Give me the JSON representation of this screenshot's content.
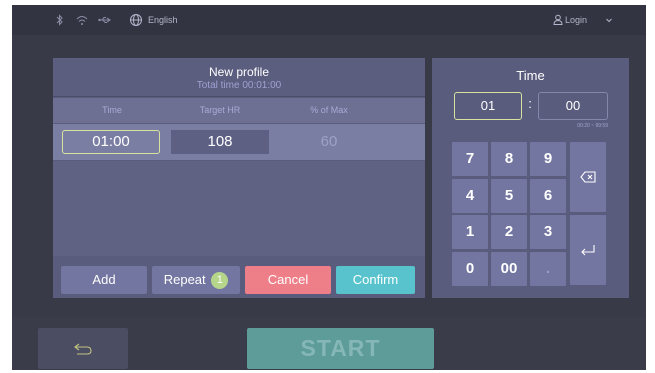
{
  "status_bar": {
    "language": "English",
    "login_label": "Login",
    "icons": [
      "bluetooth-icon",
      "wifi-icon",
      "usb-icon",
      "globe-icon",
      "user-icon",
      "chevron-down-icon"
    ]
  },
  "profile": {
    "title": "New profile",
    "subtitle": "Total time 00:01:00",
    "columns": [
      "Time",
      "Target HR",
      "% of Max"
    ],
    "rows": [
      {
        "time": "01:00",
        "target_hr": "108",
        "pct_max": "60"
      }
    ],
    "buttons": {
      "add": "Add",
      "repeat": "Repeat",
      "repeat_count": "1",
      "cancel": "Cancel",
      "confirm": "Confirm"
    }
  },
  "time_input": {
    "title": "Time",
    "minutes": "01",
    "separator": ":",
    "seconds": "00",
    "range_hint": "00:20 ~ 99:59"
  },
  "keypad": {
    "keys": [
      "7",
      "8",
      "9",
      "4",
      "5",
      "6",
      "1",
      "2",
      "3",
      "0",
      "00",
      "."
    ]
  },
  "bottom": {
    "start_label": "START"
  },
  "colors": {
    "accent_teal": "#58c3cd",
    "cancel_red": "#ee7e88",
    "selection_yellow": "#d7e2a0",
    "badge_green": "#b5d68a"
  }
}
